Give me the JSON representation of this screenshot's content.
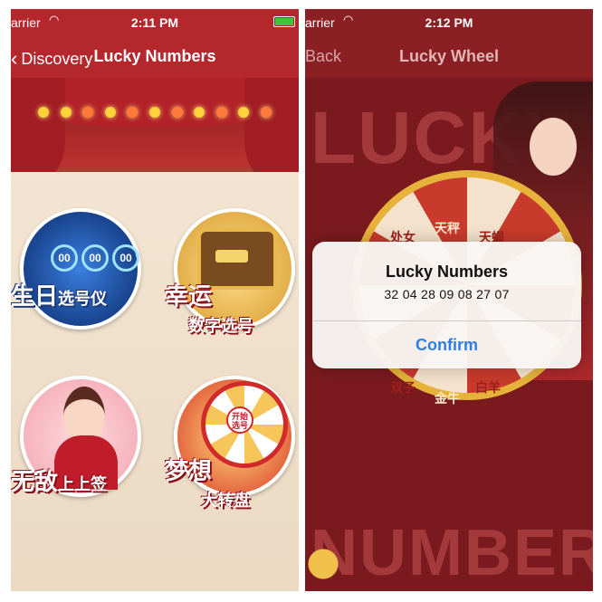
{
  "left_screen": {
    "status_bar": {
      "carrier": "arrier",
      "time": "2:11 PM",
      "wifi_icon": "wifi-icon",
      "battery_icon": "battery-icon"
    },
    "nav_bar": {
      "back_label": "Discovery",
      "title": "Lucky Numbers",
      "back_icon": "chevron-left-icon"
    },
    "features": [
      {
        "name": "birthday",
        "label_line1": "生日",
        "label_line2": "选号仪",
        "counters": [
          "00",
          "00",
          "00"
        ]
      },
      {
        "name": "lucky-digits",
        "label_line1": "幸运",
        "label_line2": "数字选号"
      },
      {
        "name": "invincible-sign",
        "label_line1": "无敌",
        "label_line2": "上上签"
      },
      {
        "name": "dream-wheel",
        "label_line1": "梦想",
        "label_line2": "大转盘",
        "hub_text": "开始选号"
      }
    ]
  },
  "right_screen": {
    "status_bar": {
      "carrier": "arrier",
      "time": "2:12 PM",
      "wifi_icon": "wifi-icon"
    },
    "nav_bar": {
      "back_label": "Back",
      "title": "Lucky Wheel"
    },
    "background_text": {
      "top": "LUCKY",
      "bottom": "NUMBER"
    },
    "wheel_segments": [
      "天秤",
      "天蝎",
      "处女",
      "金牛",
      "白羊",
      "双子"
    ],
    "alert": {
      "title": "Lucky Numbers",
      "message": "32 04 28 09 08 27 07",
      "confirm_label": "Confirm"
    }
  },
  "colors": {
    "brand_red": "#b3272d",
    "alert_button": "#2f7de6",
    "wheel_gold": "#e6b23a"
  }
}
